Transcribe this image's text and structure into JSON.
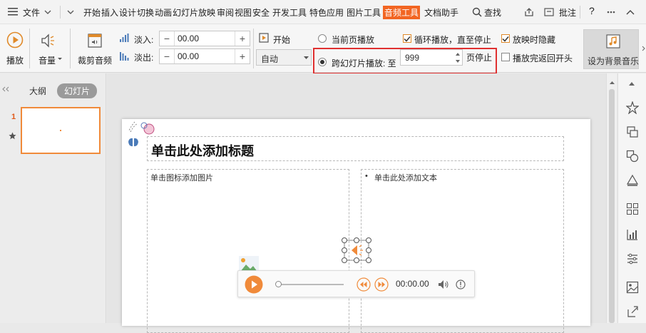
{
  "menu": {
    "file": "文件",
    "items": [
      "开始",
      "插入",
      "设计",
      "切换",
      "动画",
      "幻灯片放映",
      "审阅",
      "视图",
      "安全",
      "开发工具",
      "特色应用",
      "图片工具",
      "音频工具",
      "文档助手"
    ],
    "search": "查找",
    "annotate": "批注",
    "help": "?"
  },
  "ribbon": {
    "play": "播放",
    "volume": "音量",
    "trim": "裁剪音频",
    "fade_in_label": "淡入:",
    "fade_in_value": "00.00",
    "fade_out_label": "淡出:",
    "fade_out_value": "00.00",
    "start_label": "开始",
    "start_value": "自动",
    "current_page": "当前页播放",
    "cross_slide": "跨幻灯片播放: 至",
    "cross_slide_value": "999",
    "page_stop": "页停止",
    "loop": "循环播放，直至停止",
    "hide": "放映时隐藏",
    "rewind": "播放完返回开头",
    "set_bg_music": "设为背景音乐"
  },
  "leftpane": {
    "tab_outline": "大纲",
    "tab_slides": "幻灯片",
    "slide_number": "1"
  },
  "slide": {
    "title": "单击此处添加标题",
    "left_placeholder": "单击图标添加图片",
    "right_placeholder": "单击此处添加文本"
  },
  "player": {
    "time": "00:00.00"
  },
  "colors": {
    "accent": "#f26522",
    "highlight_box": "#e03030"
  }
}
